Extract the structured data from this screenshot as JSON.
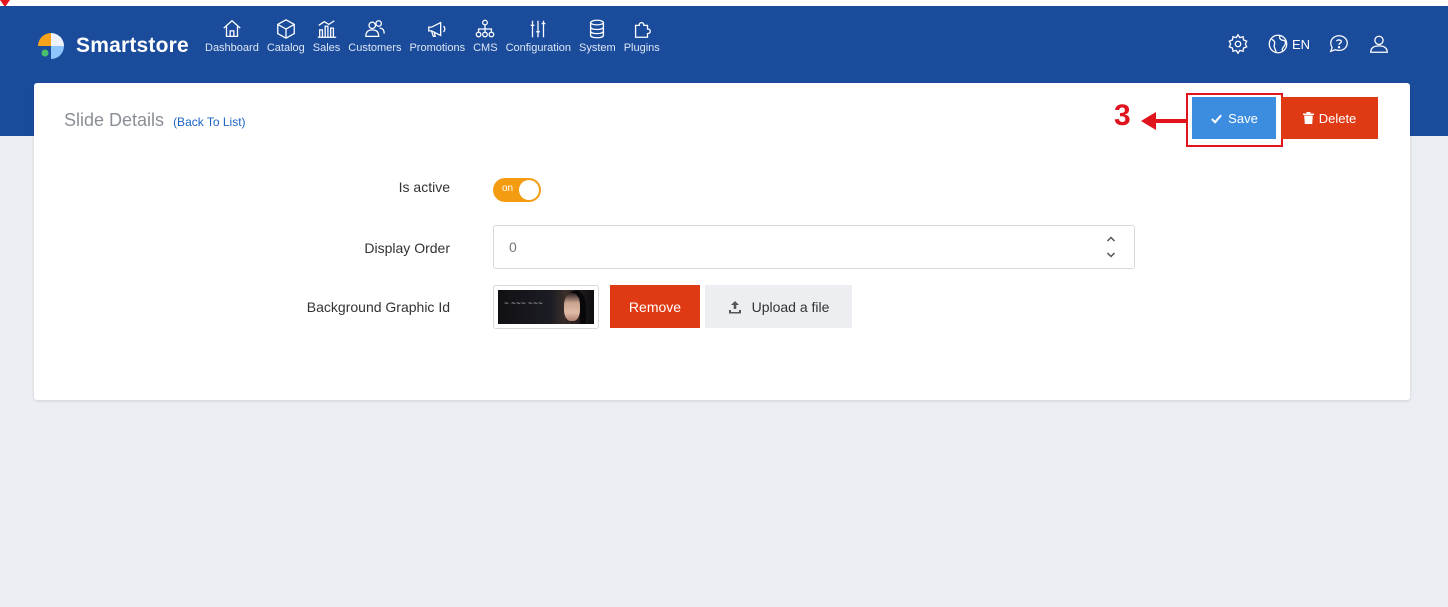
{
  "brand": {
    "name": "Smartstore"
  },
  "nav": {
    "items": [
      {
        "label": "Dashboard",
        "icon": "home-icon"
      },
      {
        "label": "Catalog",
        "icon": "cube-icon"
      },
      {
        "label": "Sales",
        "icon": "bar-chart-icon"
      },
      {
        "label": "Customers",
        "icon": "users-icon"
      },
      {
        "label": "Promotions",
        "icon": "megaphone-icon"
      },
      {
        "label": "CMS",
        "icon": "sitemap-icon"
      },
      {
        "label": "Configuration",
        "icon": "sliders-icon"
      },
      {
        "label": "System",
        "icon": "database-icon"
      },
      {
        "label": "Plugins",
        "icon": "puzzle-icon"
      }
    ],
    "language": "EN"
  },
  "page": {
    "title": "Slide Details",
    "back_link": "(Back To List)"
  },
  "actions": {
    "save_label": "Save",
    "delete_label": "Delete"
  },
  "annotation": {
    "step_number": "3",
    "color": "#e0141c"
  },
  "form": {
    "is_active": {
      "label": "Is active",
      "toggle_text": "on",
      "value": true
    },
    "display_order": {
      "label": "Display Order",
      "value": "0"
    },
    "background_graphic": {
      "label": "Background Graphic Id",
      "remove_label": "Remove",
      "upload_label": "Upload a file"
    }
  },
  "colors": {
    "navbar": "#1b4c9c",
    "accent_orange": "#f39c12",
    "danger": "#e03a14",
    "primary": "#3c8de0"
  }
}
